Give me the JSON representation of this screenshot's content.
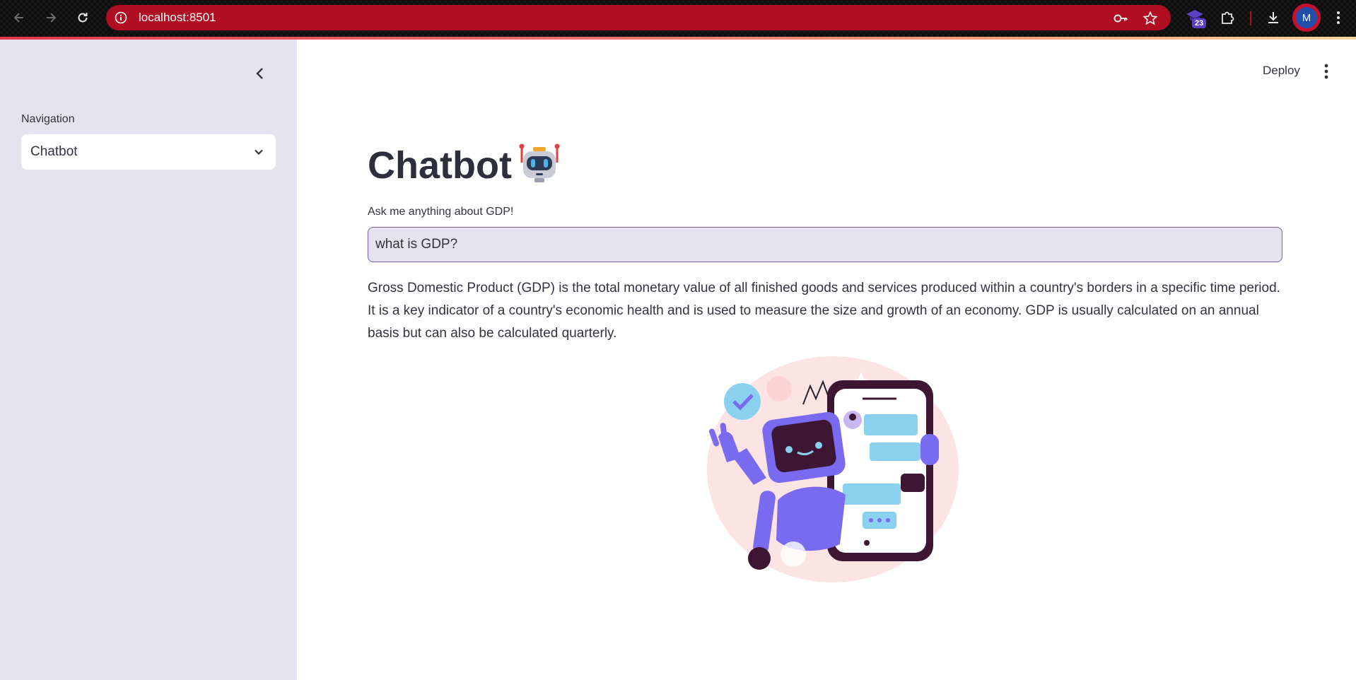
{
  "browser": {
    "url": "localhost:8501",
    "extension_badge": "23",
    "profile_initial": "M",
    "omnibox_color": "#b00e22"
  },
  "sidebar": {
    "nav_label": "Navigation",
    "nav_selected": "Chatbot",
    "background": "#e4e3ef"
  },
  "header": {
    "deploy_label": "Deploy"
  },
  "main": {
    "title": "Chatbot",
    "title_emoji_icon": "robot-face-icon",
    "input_label": "Ask me anything about GDP!",
    "input_value": "what is GDP?",
    "answer": "Gross Domestic Product (GDP) is the total monetary value of all finished goods and services produced within a country's borders in a specific time period. It is a key indicator of a country's economic health and is used to measure the size and growth of an economy. GDP is usually calculated on an annual basis but can also be calculated quarterly.",
    "illustration": "robot-chatting-on-phone-illustration"
  }
}
